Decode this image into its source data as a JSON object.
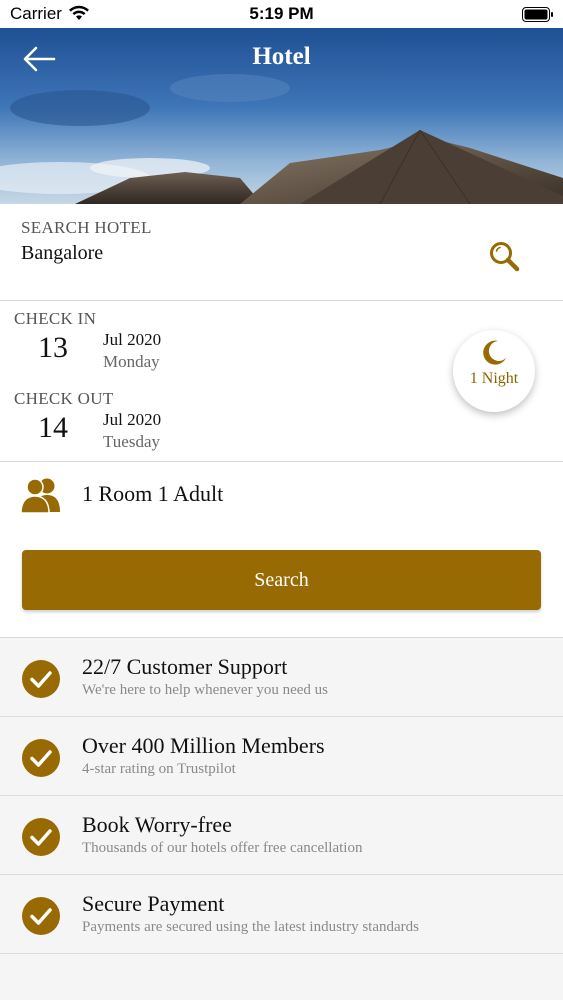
{
  "status_bar": {
    "carrier": "Carrier",
    "time": "5:19 PM"
  },
  "header": {
    "title": "Hotel",
    "back_icon": "arrow-left-icon"
  },
  "search": {
    "label": "SEARCH HOTEL",
    "value": "Bangalore",
    "icon": "search-icon"
  },
  "check_in": {
    "label": "CHECK IN",
    "day": "13",
    "month_year": "Jul 2020",
    "weekday": "Monday"
  },
  "check_out": {
    "label": "CHECK OUT",
    "day": "14",
    "month_year": "Jul 2020",
    "weekday": "Tuesday"
  },
  "nights": {
    "text": "1 Night",
    "icon": "moon-icon"
  },
  "guests": {
    "text": "1 Room 1 Adult",
    "icon": "people-icon"
  },
  "search_button": {
    "label": "Search"
  },
  "features": [
    {
      "title": "22/7 Customer Support",
      "subtitle": "We're here to help whenever you need us"
    },
    {
      "title": "Over 400 Million Members",
      "subtitle": "4-star rating on Trustpilot"
    },
    {
      "title": "Book Worry-free",
      "subtitle": "Thousands of our hotels offer free cancellation"
    },
    {
      "title": "Secure Payment",
      "subtitle": "Payments are secured using the latest industry standards"
    }
  ],
  "colors": {
    "accent": "#976a03",
    "text_secondary": "#8a8a8a"
  }
}
